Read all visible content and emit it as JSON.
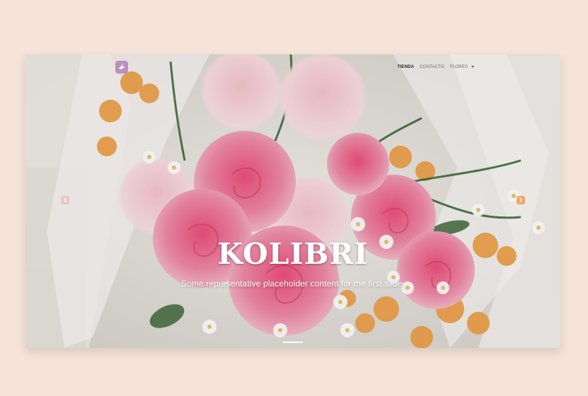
{
  "nav": {
    "items": [
      {
        "label": "TIENDA",
        "state": "active"
      },
      {
        "label": "CONTACTO",
        "state": "normal"
      },
      {
        "label": "FLORES",
        "state": "dropdown"
      }
    ]
  },
  "hero": {
    "title": "KOLIBRI",
    "subtitle": "Some representative placeholder content for the first slide."
  },
  "icons": {
    "logo": "hummingbird-logo-icon",
    "prev": "chevron-left-icon",
    "next": "chevron-right-icon",
    "dropdown": "caret-down-icon"
  },
  "colors": {
    "page_background": "#f6e4da",
    "logo_background": "#b990c0",
    "next_arrow": "#f0934a",
    "prev_arrow": "#e5a990",
    "text_light": "#ffffff",
    "nav_text": "#3b3b3b"
  }
}
